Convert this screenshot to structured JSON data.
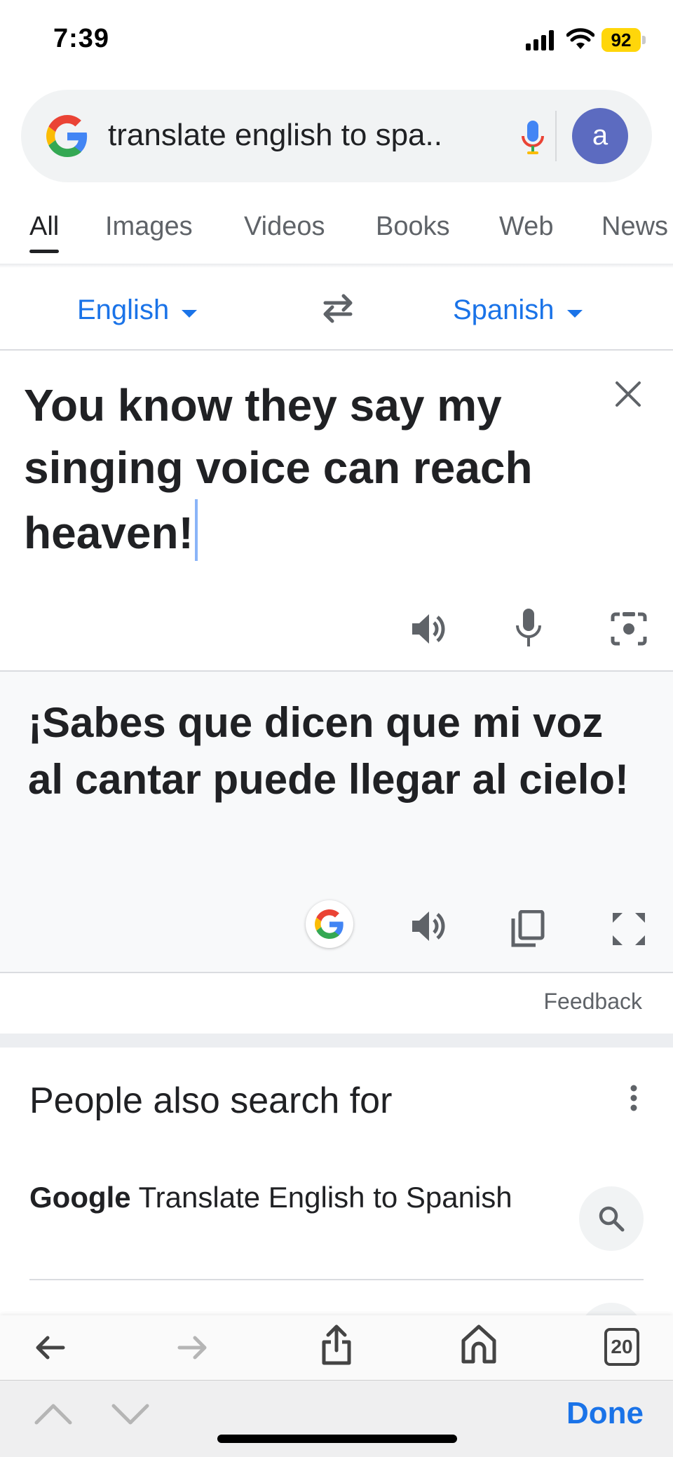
{
  "status": {
    "time": "7:39",
    "battery": "92"
  },
  "search": {
    "query": "translate english to spa..",
    "avatar_letter": "a"
  },
  "tabs": [
    {
      "label": "All"
    },
    {
      "label": "Images"
    },
    {
      "label": "Videos"
    },
    {
      "label": "Books"
    },
    {
      "label": "Web"
    },
    {
      "label": "News"
    }
  ],
  "translate": {
    "source_lang": "English",
    "target_lang": "Spanish",
    "source_text": "You know they say my singing voice can reach heaven!",
    "translated_text": "¡Sabes que dicen que mi voz al cantar puede llegar al cielo!",
    "feedback_label": "Feedback"
  },
  "pasf": {
    "title": "People also search for",
    "items": [
      {
        "bold": "Google",
        "rest": " Translate English to Spanish"
      }
    ]
  },
  "browser": {
    "tab_count": "20",
    "done_label": "Done"
  },
  "colors": {
    "accent": "#1a73e8",
    "avatar": "#5c6bc0",
    "battery": "#ffd60a"
  },
  "icons": [
    "back-arrow-icon",
    "forward-arrow-icon",
    "share-icon",
    "home-icon",
    "tabs-icon",
    "speaker-icon",
    "mic-icon",
    "camera-icon",
    "copy-icon",
    "fullscreen-icon",
    "close-icon",
    "swap-icon",
    "search-icon",
    "more-vert-icon",
    "chevron-up-icon",
    "chevron-down-icon"
  ]
}
